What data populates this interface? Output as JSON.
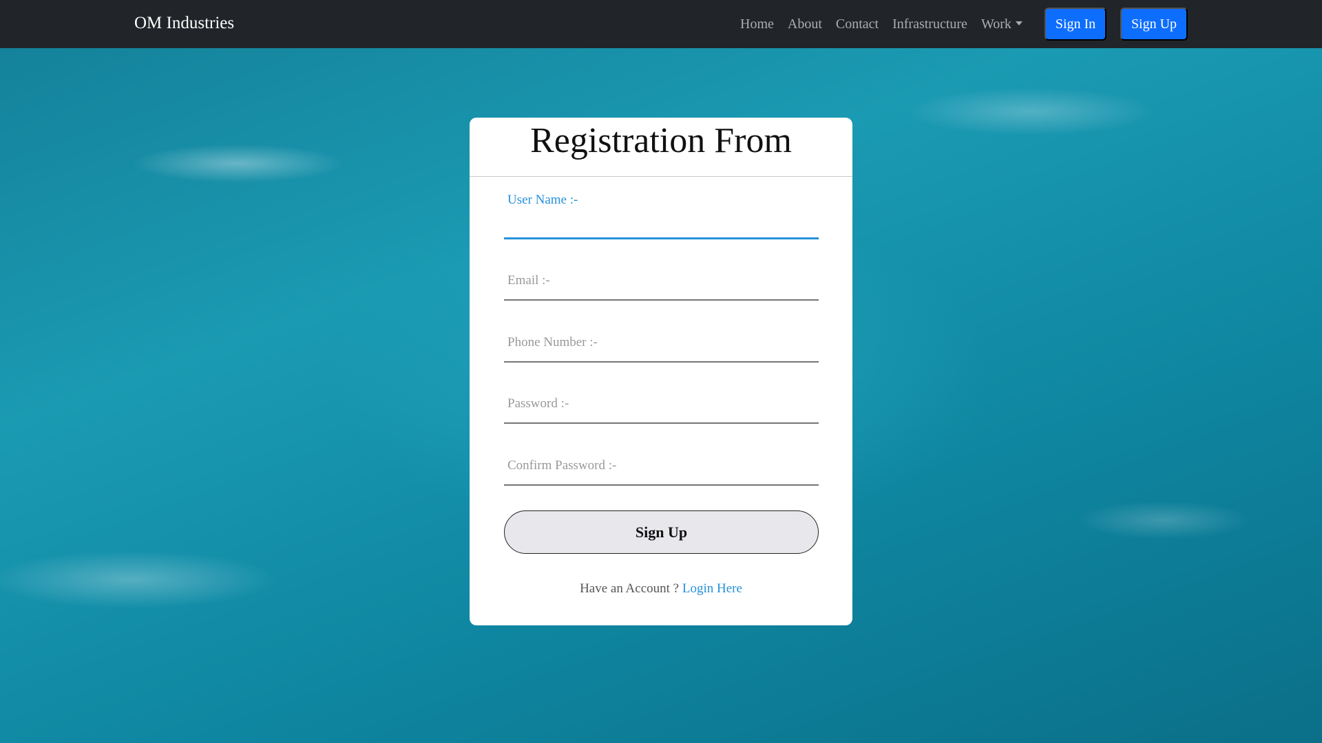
{
  "navbar": {
    "brand": "OM Industries",
    "links": [
      {
        "label": "Home"
      },
      {
        "label": "About"
      },
      {
        "label": "Contact"
      },
      {
        "label": "Infrastructure"
      },
      {
        "label": "Work"
      }
    ],
    "sign_in_label": "Sign In",
    "sign_up_label": "Sign Up",
    "bg_color": "#212529",
    "button_color": "#0d6efd"
  },
  "form": {
    "title": "Registration From",
    "fields": [
      {
        "label": "User Name :-",
        "value": "",
        "active": true
      },
      {
        "label": "Email :-",
        "value": ""
      },
      {
        "label": "Phone Number :-",
        "value": ""
      },
      {
        "label": "Password :-",
        "value": ""
      },
      {
        "label": "Confirm Password :-",
        "value": ""
      }
    ],
    "submit_label": "Sign Up",
    "footer_text": "Have an Account ?",
    "footer_link": "Login Here",
    "accent_color": "#2691d9"
  },
  "background": {
    "icon": "ocean-water-image"
  }
}
